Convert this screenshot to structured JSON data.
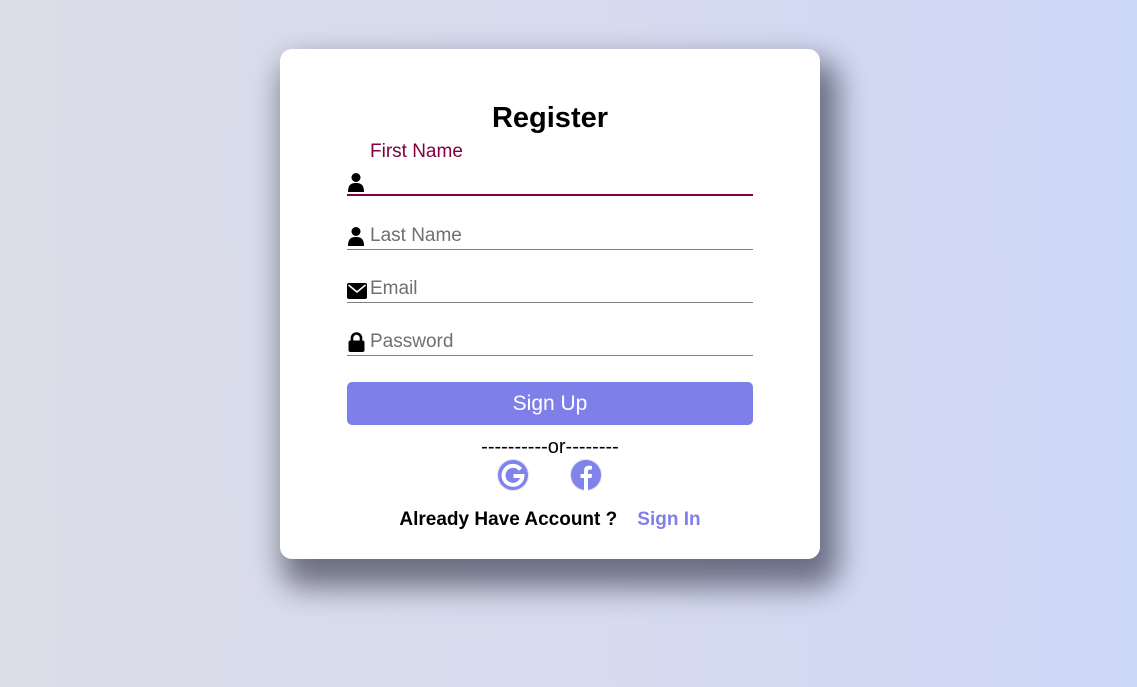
{
  "form": {
    "title": "Register",
    "fields": [
      {
        "label": "First Name",
        "icon": "user-icon",
        "state": "focused"
      },
      {
        "label": "Last Name",
        "icon": "user-icon"
      },
      {
        "label": "Email",
        "icon": "envelope-icon"
      },
      {
        "label": "Password",
        "icon": "lock-icon"
      }
    ],
    "submit_label": "Sign Up",
    "divider": "----------or--------",
    "social": [
      {
        "name": "google",
        "icon": "google-icon"
      },
      {
        "name": "facebook",
        "icon": "facebook-icon"
      }
    ],
    "footer_question": "Already Have Account ?",
    "footer_link": "Sign In"
  },
  "colors": {
    "accent": "#7f7fea",
    "focus": "#800040",
    "underline": "#808080",
    "placeholder": "#707070"
  }
}
